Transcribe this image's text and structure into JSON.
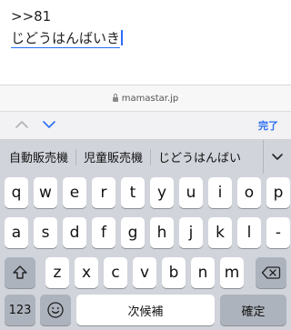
{
  "editor": {
    "line1": ">>81",
    "line2": "じどうはんばいき"
  },
  "urlbar": {
    "domain": "mamastar.jp"
  },
  "accessory": {
    "done_label": "完了"
  },
  "keyboard": {
    "candidates": [
      "自動販売機",
      "児童販売機",
      "じどうはんばい"
    ],
    "row1": [
      "q",
      "w",
      "e",
      "r",
      "t",
      "y",
      "u",
      "i",
      "o",
      "p"
    ],
    "row2": [
      "a",
      "s",
      "d",
      "f",
      "g",
      "h",
      "j",
      "k",
      "l",
      "-"
    ],
    "row3": [
      "z",
      "x",
      "c",
      "v",
      "b",
      "n",
      "m"
    ],
    "numbers_label": "123",
    "space_label": "次候補",
    "return_label": "確定"
  }
}
